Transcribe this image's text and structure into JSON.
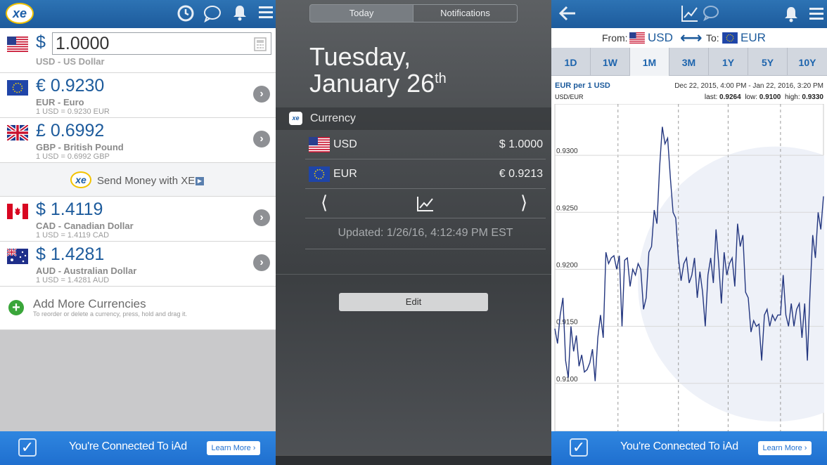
{
  "converter": {
    "base": {
      "symbol": "$",
      "amount": "1.0000",
      "label": "USD - US Dollar"
    },
    "rows": [
      {
        "value": "€ 0.9230",
        "name": "EUR - Euro",
        "rate": "1 USD = 0.9230 EUR"
      },
      {
        "value": "£ 0.6992",
        "name": "GBP - British Pound",
        "rate": "1 USD = 0.6992 GBP"
      },
      {
        "value": "$ 1.4119",
        "name": "CAD - Canadian Dollar",
        "rate": "1 USD = 1.4119 CAD"
      },
      {
        "value": "$ 1.4281",
        "name": "AUD - Australian Dollar",
        "rate": "1 USD = 1.4281 AUD"
      }
    ],
    "send_money": "Send Money with XE",
    "add_more": "Add More Currencies",
    "add_hint": "To reorder or delete a currency, press, hold and drag it.",
    "logo": "xe"
  },
  "ad": {
    "text": "You're Connected To iAd",
    "button": "Learn More ›"
  },
  "widget": {
    "tab_today": "Today",
    "tab_notifications": "Notifications",
    "weekday": "Tuesday,",
    "date": "January 26",
    "date_suffix": "th",
    "section": "Currency",
    "rows": [
      {
        "code": "USD",
        "value": "$ 1.0000"
      },
      {
        "code": "EUR",
        "value": "€ 0.9213"
      }
    ],
    "prev": "⟨",
    "next": "⟩",
    "updated": "Updated: 1/26/16, 4:12:49 PM EST",
    "edit": "Edit"
  },
  "chart_screen": {
    "from_label": "From:",
    "from_code": "USD",
    "to_label": "To:",
    "to_code": "EUR",
    "swap": "⟷",
    "tabs": [
      "1D",
      "1W",
      "1M",
      "3M",
      "1Y",
      "5Y",
      "10Y"
    ],
    "selected_tab": "1M",
    "title": "EUR per 1 USD",
    "pair": "USD/EUR",
    "range": "Dec 22, 2015, 4:00 PM - Jan 22, 2016, 3:20 PM",
    "last_label": "last:",
    "last": "0.9264",
    "low_label": "low:",
    "low": "0.9100",
    "high_label": "high:",
    "high": "0.9330"
  },
  "chart_data": {
    "type": "line",
    "title": "EUR per 1 USD",
    "ylim": [
      0.9058,
      0.9345
    ],
    "yticks": [
      "0.9300",
      "0.9250",
      "0.9200",
      "0.9150",
      "0.9100"
    ],
    "ytick_values": [
      0.93,
      0.925,
      0.92,
      0.915,
      0.91
    ],
    "xlim": [
      0,
      100
    ],
    "series": [
      {
        "x": [
          0,
          1,
          2,
          3,
          4,
          5,
          6,
          7,
          8,
          9,
          10,
          11,
          12,
          13,
          14,
          15,
          16,
          17,
          18,
          19,
          20,
          21,
          22,
          23,
          24,
          25,
          26,
          27,
          28,
          29,
          30,
          31,
          32,
          33,
          34,
          35,
          36,
          37,
          38,
          39,
          40,
          41,
          42,
          43,
          44,
          45,
          46,
          47,
          48,
          49,
          50,
          51,
          52,
          53,
          54,
          55,
          56,
          57,
          58,
          59,
          60,
          61,
          62,
          63,
          64,
          65,
          66,
          67,
          68,
          69,
          70,
          71,
          72,
          73,
          74,
          75,
          76,
          77,
          78,
          79,
          80,
          81,
          82,
          83,
          84,
          85,
          86,
          87,
          88,
          89,
          90,
          91,
          92,
          93,
          94,
          95,
          96,
          97,
          98,
          99,
          100
        ],
        "y": [
          0.9148,
          0.9135,
          0.916,
          0.9175,
          0.912,
          0.9105,
          0.915,
          0.9128,
          0.9142,
          0.9115,
          0.9125,
          0.911,
          0.9112,
          0.9118,
          0.913,
          0.9102,
          0.914,
          0.916,
          0.914,
          0.9215,
          0.9205,
          0.921,
          0.9212,
          0.92,
          0.9212,
          0.915,
          0.9208,
          0.921,
          0.9185,
          0.92,
          0.9195,
          0.9205,
          0.92,
          0.9165,
          0.9175,
          0.9215,
          0.922,
          0.9252,
          0.924,
          0.929,
          0.9325,
          0.931,
          0.9315,
          0.928,
          0.925,
          0.9245,
          0.921,
          0.919,
          0.9205,
          0.921,
          0.9188,
          0.9195,
          0.921,
          0.9175,
          0.9198,
          0.918,
          0.915,
          0.9195,
          0.921,
          0.9188,
          0.9235,
          0.9205,
          0.917,
          0.9215,
          0.9195,
          0.9205,
          0.921,
          0.9185,
          0.924,
          0.922,
          0.923,
          0.918,
          0.9175,
          0.9145,
          0.9155,
          0.915,
          0.9152,
          0.912,
          0.916,
          0.9165,
          0.915,
          0.916,
          0.9155,
          0.916,
          0.916,
          0.9195,
          0.916,
          0.915,
          0.917,
          0.915,
          0.9165,
          0.917,
          0.914,
          0.917,
          0.912,
          0.918,
          0.923,
          0.921,
          0.925,
          0.9235,
          0.9264
        ]
      }
    ]
  }
}
